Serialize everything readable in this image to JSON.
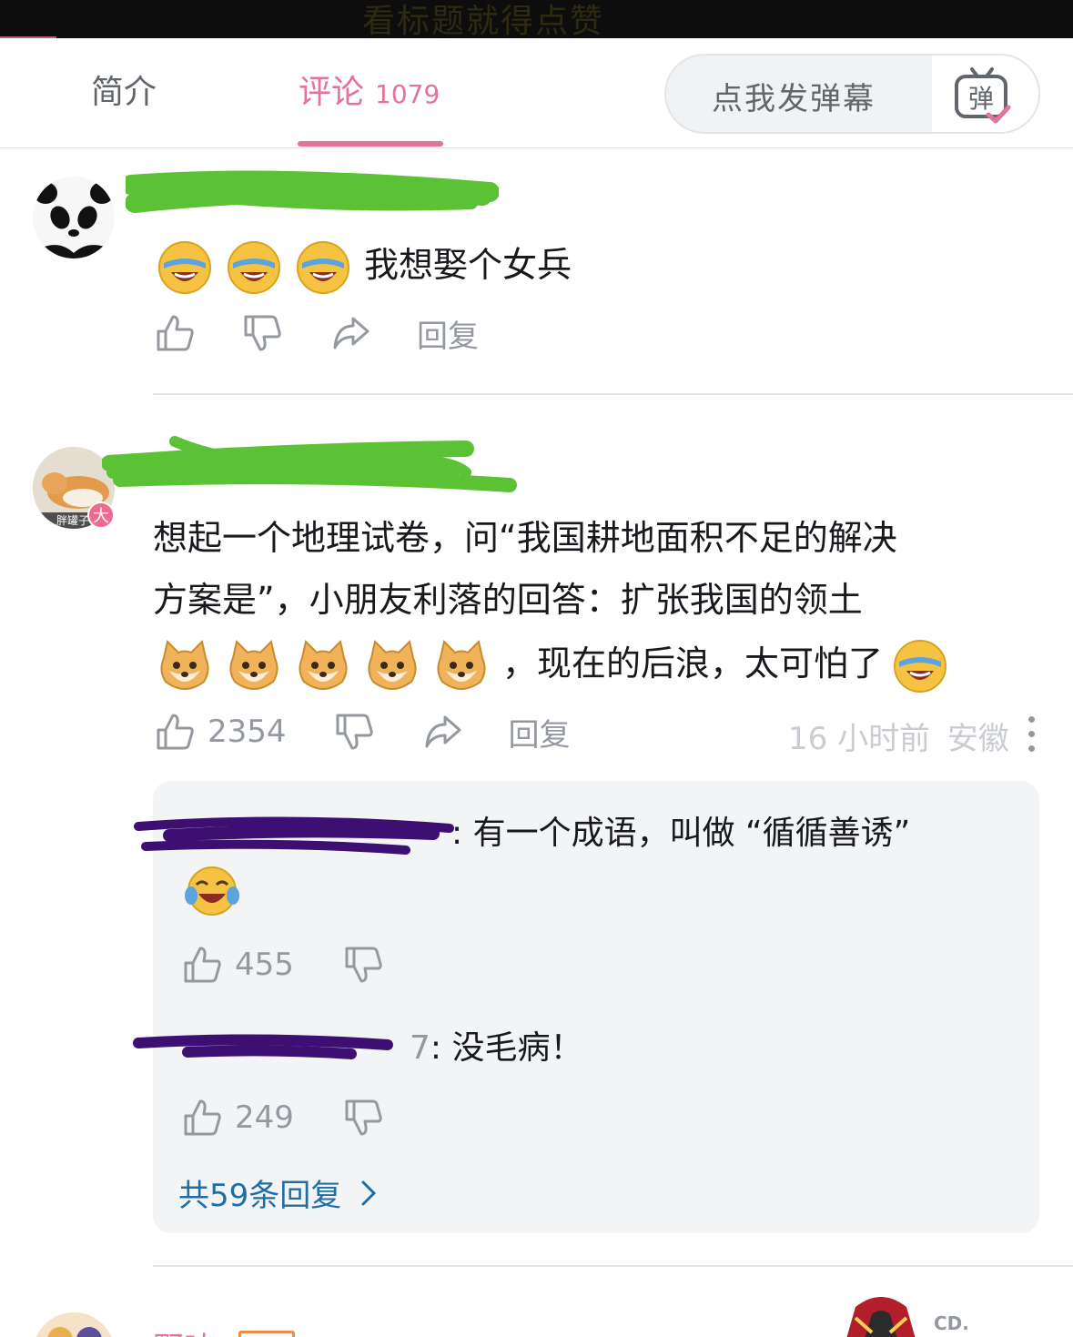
{
  "video": {
    "subtitle": "看标题就得点赞"
  },
  "tabs": {
    "intro_label": "简介",
    "comments_label": "评论",
    "comments_count": "1079"
  },
  "danmaku": {
    "placeholder": "点我发弹幕",
    "button_glyph": "弹"
  },
  "comments": [
    {
      "text": "我想娶个女兵",
      "reply_label": "回复"
    },
    {
      "line1": "想起一个地理试卷，问“我国耕地面积不足的解决",
      "line2": "方案是”，小朋友利落的回答：扩张我国的领土",
      "line3": "，现在的后浪，太可怕了",
      "avatar_caption": "胖罐子",
      "badge": "大",
      "likes": "2354",
      "reply_label": "回复",
      "time": "16 小时前",
      "location": "安徽",
      "replies": [
        {
          "text": ": 有一个成语，叫做 “循循善诱”",
          "likes": "455"
        },
        {
          "uname_tail": "7",
          "text": ": 没毛病！",
          "likes": "249"
        }
      ],
      "replies_total": "共59条回复"
    },
    {
      "name_partial": "野味",
      "side_label": "CD."
    }
  ],
  "colors": {
    "accent_pink": "#e2739a",
    "link_blue": "#1f6fa5",
    "text_gray": "#9499a0",
    "scribble_green": "#5bc236",
    "scribble_purple": "#3d0f73"
  },
  "icons": [
    "thumb-up-icon",
    "thumb-down-icon",
    "share-icon",
    "danmaku-tv-icon",
    "chevron-right-icon",
    "laughing-emoji",
    "doge-emoji",
    "tears-of-joy-emoji",
    "more-dots-icon"
  ]
}
